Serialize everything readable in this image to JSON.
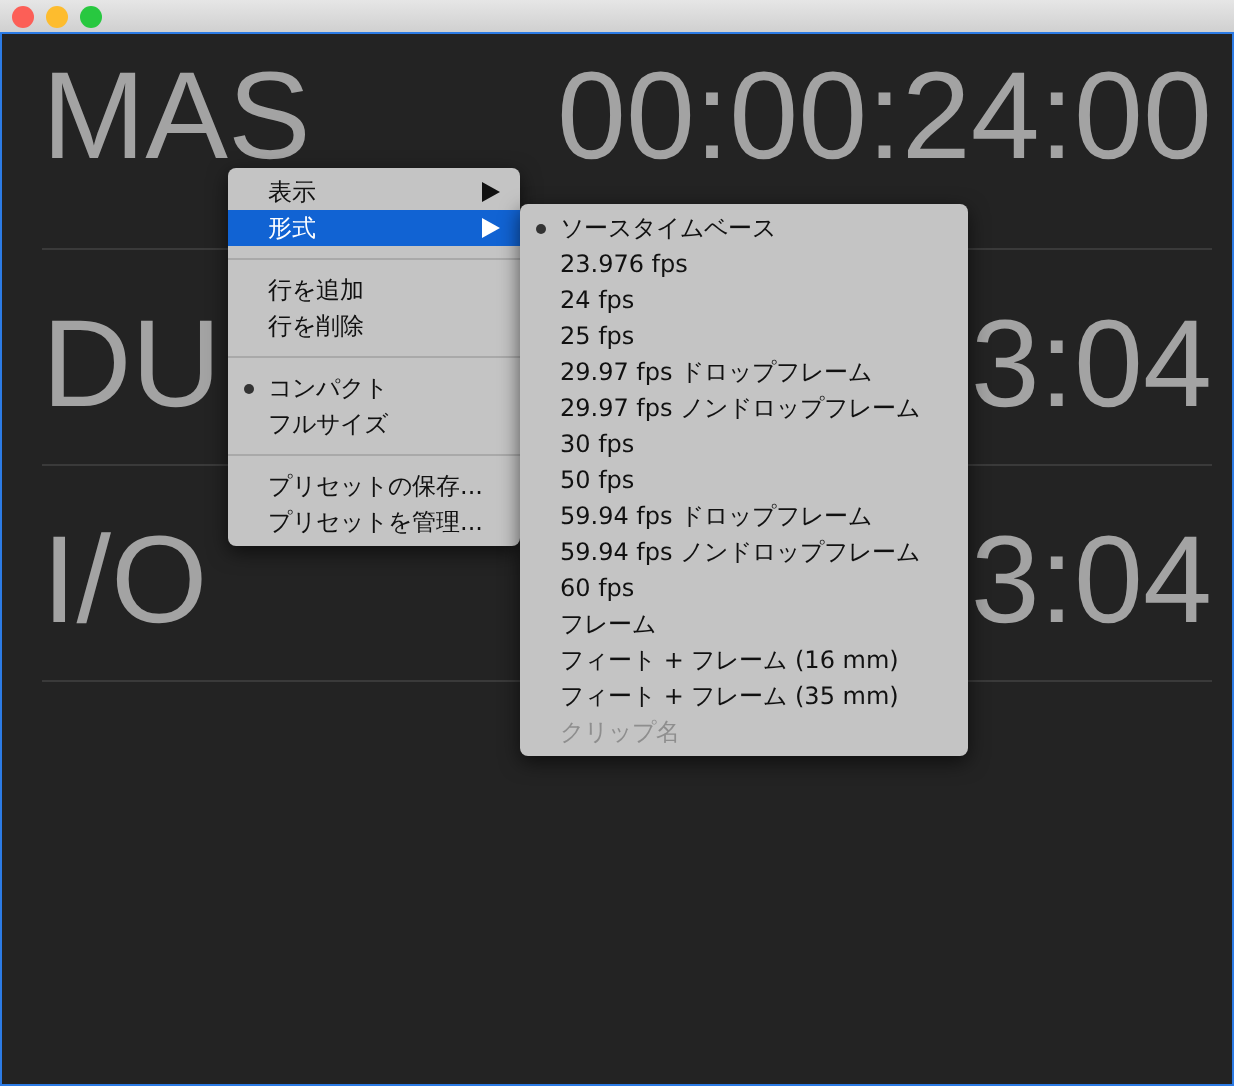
{
  "rows": [
    {
      "label": "MAS",
      "timecode": "00:00:24:00"
    },
    {
      "label": "DU",
      "timecode": "3:04"
    },
    {
      "label": "I/O",
      "timecode": "3:04"
    }
  ],
  "context_menu": {
    "groups": [
      [
        {
          "label": "表示",
          "submenu": true,
          "selected": false
        },
        {
          "label": "形式",
          "submenu": true,
          "selected": true
        }
      ],
      [
        {
          "label": "行を追加",
          "selected": false
        },
        {
          "label": "行を削除",
          "selected": false
        }
      ],
      [
        {
          "label": "コンパクト",
          "checked": true,
          "selected": false
        },
        {
          "label": "フルサイズ",
          "checked": false,
          "selected": false
        }
      ],
      [
        {
          "label": "プリセットの保存...",
          "selected": false
        },
        {
          "label": "プリセットを管理...",
          "selected": false
        }
      ]
    ]
  },
  "submenu": {
    "items": [
      {
        "label": "ソースタイムベース",
        "checked": true,
        "disabled": false
      },
      {
        "label": "23.976 fps",
        "checked": false,
        "disabled": false
      },
      {
        "label": "24 fps",
        "checked": false,
        "disabled": false
      },
      {
        "label": "25 fps",
        "checked": false,
        "disabled": false
      },
      {
        "label": "29.97 fps ドロップフレーム",
        "checked": false,
        "disabled": false
      },
      {
        "label": "29.97 fps ノンドロップフレーム",
        "checked": false,
        "disabled": false
      },
      {
        "label": "30 fps",
        "checked": false,
        "disabled": false
      },
      {
        "label": "50 fps",
        "checked": false,
        "disabled": false
      },
      {
        "label": "59.94 fps ドロップフレーム",
        "checked": false,
        "disabled": false
      },
      {
        "label": "59.94 fps ノンドロップフレーム",
        "checked": false,
        "disabled": false
      },
      {
        "label": "60 fps",
        "checked": false,
        "disabled": false
      },
      {
        "label": "フレーム",
        "checked": false,
        "disabled": false
      },
      {
        "label": "フィート + フレーム (16 mm)",
        "checked": false,
        "disabled": false
      },
      {
        "label": "フィート + フレーム (35 mm)",
        "checked": false,
        "disabled": false
      },
      {
        "label": "クリップ名",
        "checked": false,
        "disabled": true
      }
    ]
  }
}
